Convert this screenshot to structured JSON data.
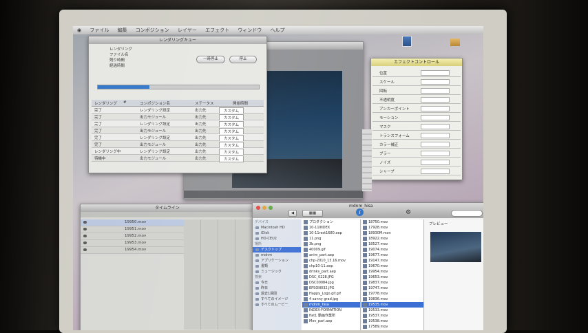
{
  "menubar": {
    "items": [
      "ファイル",
      "編集",
      "コンポジション",
      "レイヤー",
      "エフェクト",
      "ウィンドウ",
      "ヘルプ"
    ]
  },
  "render_dialog": {
    "title": "レンダリングキュー",
    "info_lines": [
      "レンダリング",
      "ファイル名",
      "残り時間",
      "経過時間"
    ],
    "progress": 0.32,
    "btn_stop": "一時停止",
    "btn_cancel": "停止",
    "col_headers": [
      "レンダリング",
      "#",
      "コンポジション名",
      "ステータス",
      "開始時間"
    ],
    "rows": [
      {
        "status": "完了",
        "name": "レンダリング設定",
        "output": "出力先",
        "fmt": "カスタム"
      },
      {
        "status": "完了",
        "name": "出力モジュール",
        "output": "出力先",
        "fmt": "カスタム"
      },
      {
        "status": "完了",
        "name": "レンダリング設定",
        "output": "出力先",
        "fmt": "カスタム"
      },
      {
        "status": "完了",
        "name": "出力モジュール",
        "output": "出力先",
        "fmt": "カスタム"
      },
      {
        "status": "完了",
        "name": "レンダリング設定",
        "output": "出力先",
        "fmt": "カスタム"
      },
      {
        "status": "完了",
        "name": "出力モジュール",
        "output": "出力先",
        "fmt": "カスタム"
      },
      {
        "status": "レンダリング中",
        "name": "レンダリング設定",
        "output": "出力先",
        "fmt": "カスタム"
      },
      {
        "status": "待機中",
        "name": "出力モジュール",
        "output": "出力先",
        "fmt": "カスタム"
      }
    ]
  },
  "timeline": {
    "title": "タイムライン",
    "layers": [
      "19950.mov",
      "19951.mov",
      "19952.mov",
      "19953.mov",
      "19954.mov"
    ]
  },
  "finder": {
    "title": "mdnm_hisa",
    "search_placeholder": "",
    "sidebar": {
      "devices_header": "デバイス",
      "devices": [
        "Macintosh HD",
        "iDisk",
        "HD-CEU2"
      ],
      "places_header": "場所",
      "places": [
        "デスクトップ",
        "mdnm",
        "アプリケーション",
        "書類",
        "ミュージック"
      ],
      "search_header": "検索",
      "search": [
        "今日",
        "昨日",
        "過去1週間",
        "すべてのイメージ",
        "すべてのムービー"
      ]
    },
    "col1": [
      "プロダクション",
      "10-11INDEX",
      "10-11rest1680.aep",
      "11.png",
      "3b.png",
      "40009.gif",
      "anim_part.aep",
      "chp-2010_13.16.mov",
      "chp10-11.aep",
      "drinks_part.aep",
      "DSC_0228.JPG",
      "DSC00084.jpg",
      "EPSON032.JPG",
      "Happy_Logo.gif.gif",
      "4 sanny grad.jpg",
      "mdnm_hisa",
      "INDEX-FORMATION",
      "flat1 動画作業所",
      "Mov_parl.aep"
    ],
    "col1_selected": 15,
    "col2": [
      "18750.mov",
      "17928.mov",
      "18930M.mov",
      "18922.mov",
      "18527.mov",
      "19074.mov",
      "19677.mov",
      "19147.mov",
      "19670.mov",
      "19954.mov",
      "19653.mov",
      "19837.mov",
      "19747.mov",
      "19778.mov",
      "19836.mov",
      "19535.mov",
      "19533.mov",
      "19537.mov",
      "19538.mov",
      "17589.mov"
    ],
    "col2_selected": 15,
    "preview_header": "プレビュー"
  },
  "props_panel": {
    "title": "エフェクトコントロール",
    "rows": [
      "位置",
      "スケール",
      "回転",
      "不透明度",
      "アンカーポイント",
      "モーション",
      "マスク",
      "トランスフォーム",
      "カラー補正",
      "ブラー",
      "ノイズ",
      "シャープ"
    ]
  },
  "colors": {
    "selection": "#3b6fd4",
    "progress": "#2f74c9"
  }
}
